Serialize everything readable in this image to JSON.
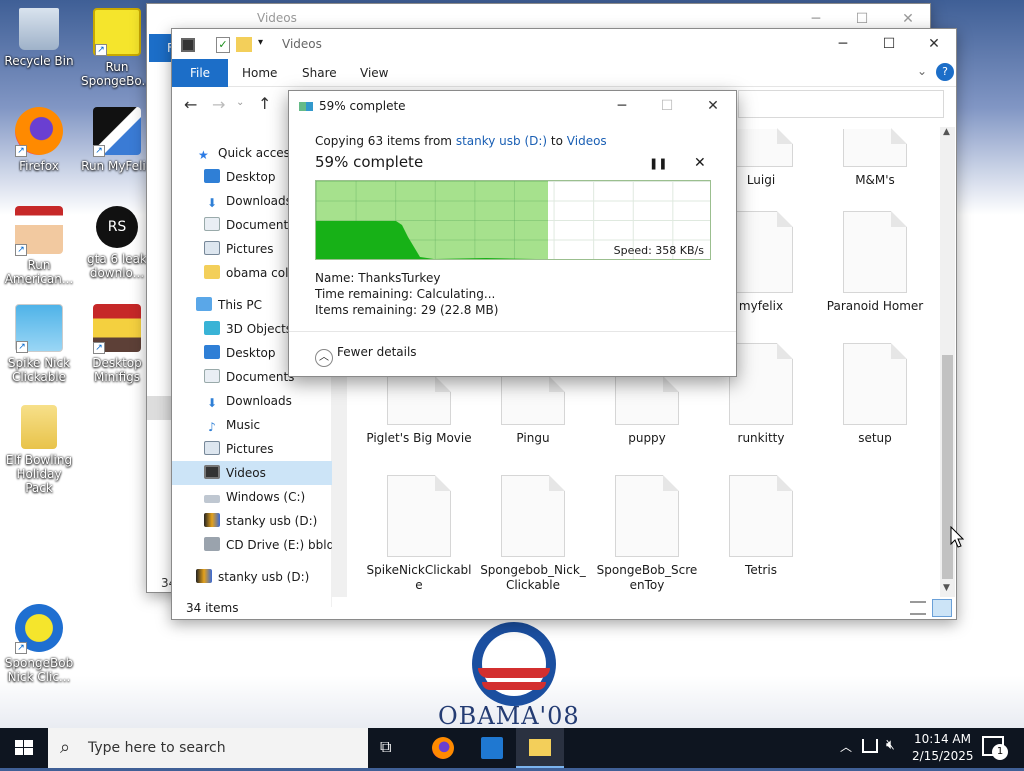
{
  "desktop": {
    "icons": [
      {
        "label": "Recycle Bin",
        "icon": "recycle-bin-icon"
      },
      {
        "label": "Run SpongeBo...",
        "icon": "spongebob-icon"
      },
      {
        "label": "Firefox",
        "icon": "firefox-icon"
      },
      {
        "label": "Run MyFelix",
        "icon": "felix-icon"
      },
      {
        "label": "Run American...",
        "icon": "american-dad-icon"
      },
      {
        "label": "gta 6 leak downlo...",
        "icon": "rs-icon"
      },
      {
        "label": "Spike Nick Clickable",
        "icon": "spike-icon"
      },
      {
        "label": "Desktop Minifigs",
        "icon": "minifig-icon"
      },
      {
        "label": "Elf Bowling Holiday Pack",
        "icon": "folder-zip-icon"
      },
      {
        "label": "SpongeBob Nick Clic...",
        "icon": "spongebob-nick-icon"
      }
    ],
    "wallpaper_text": "OBAMA'08"
  },
  "back_window": {
    "title": "Videos",
    "status_partial": "34",
    "ribbon_partial": "F"
  },
  "explorer": {
    "title": "Videos",
    "ribbon_tabs": [
      "File",
      "Home",
      "Share",
      "View"
    ],
    "nav": [
      {
        "label": "Quick access",
        "icon": "star-icon"
      },
      {
        "label": "Desktop",
        "icon": "desktop-icon"
      },
      {
        "label": "Downloads",
        "icon": "download-icon"
      },
      {
        "label": "Documents",
        "icon": "documents-icon"
      },
      {
        "label": "Pictures",
        "icon": "pictures-icon"
      },
      {
        "label": "obama colle",
        "icon": "folder-icon"
      },
      {
        "label": "This PC",
        "icon": "pc-icon"
      },
      {
        "label": "3D Objects",
        "icon": "3d-objects-icon"
      },
      {
        "label": "Desktop",
        "icon": "desktop-icon"
      },
      {
        "label": "Documents",
        "icon": "documents-icon"
      },
      {
        "label": "Downloads",
        "icon": "download-icon"
      },
      {
        "label": "Music",
        "icon": "music-icon"
      },
      {
        "label": "Pictures",
        "icon": "pictures-icon"
      },
      {
        "label": "Videos",
        "icon": "videos-icon"
      },
      {
        "label": "Windows (C:)",
        "icon": "drive-icon"
      },
      {
        "label": "stanky usb (D:)",
        "icon": "usb-icon"
      },
      {
        "label": "CD Drive (E:) bbldriz",
        "icon": "cd-icon"
      },
      {
        "label": "stanky usb (D:)",
        "icon": "usb-icon"
      }
    ],
    "files": [
      {
        "name": "Luigi"
      },
      {
        "name": "M&M's"
      },
      {
        "name": "myfelix"
      },
      {
        "name": "Paranoid Homer"
      },
      {
        "name": "Piglet's Big Movie"
      },
      {
        "name": "Pingu"
      },
      {
        "name": "puppy"
      },
      {
        "name": "runkitty"
      },
      {
        "name": "setup"
      },
      {
        "name": "SpikeNickClickable"
      },
      {
        "name": "Spongebob_Nick_Clickable"
      },
      {
        "name": "SpongeBob_ScreenToy"
      },
      {
        "name": "Tetris"
      }
    ],
    "status": "34 items"
  },
  "copy_dialog": {
    "title": "59% complete",
    "copy_prefix": "Copying 63 items from ",
    "source": "stanky usb (D:)",
    "to_word": " to ",
    "dest": "Videos",
    "percent_text": "59% complete",
    "progress": 0.59,
    "speed": "Speed: 358 KB/s",
    "name_label": "Name:",
    "name_value": "ThanksTurkey",
    "time_label": "Time remaining:",
    "time_value": "Calculating...",
    "items_label": "Items remaining:",
    "items_value": "29 (22.8 MB)",
    "fewer_details": "Fewer details",
    "colors": {
      "fill": "#a6e18d",
      "graph": "#17b117"
    }
  },
  "taskbar": {
    "search_placeholder": "Type here to search",
    "time": "10:14 AM",
    "date": "2/15/2025",
    "notif_count": "1",
    "apps": [
      "task-view-icon",
      "firefox-icon",
      "store-icon",
      "file-explorer-icon"
    ]
  }
}
